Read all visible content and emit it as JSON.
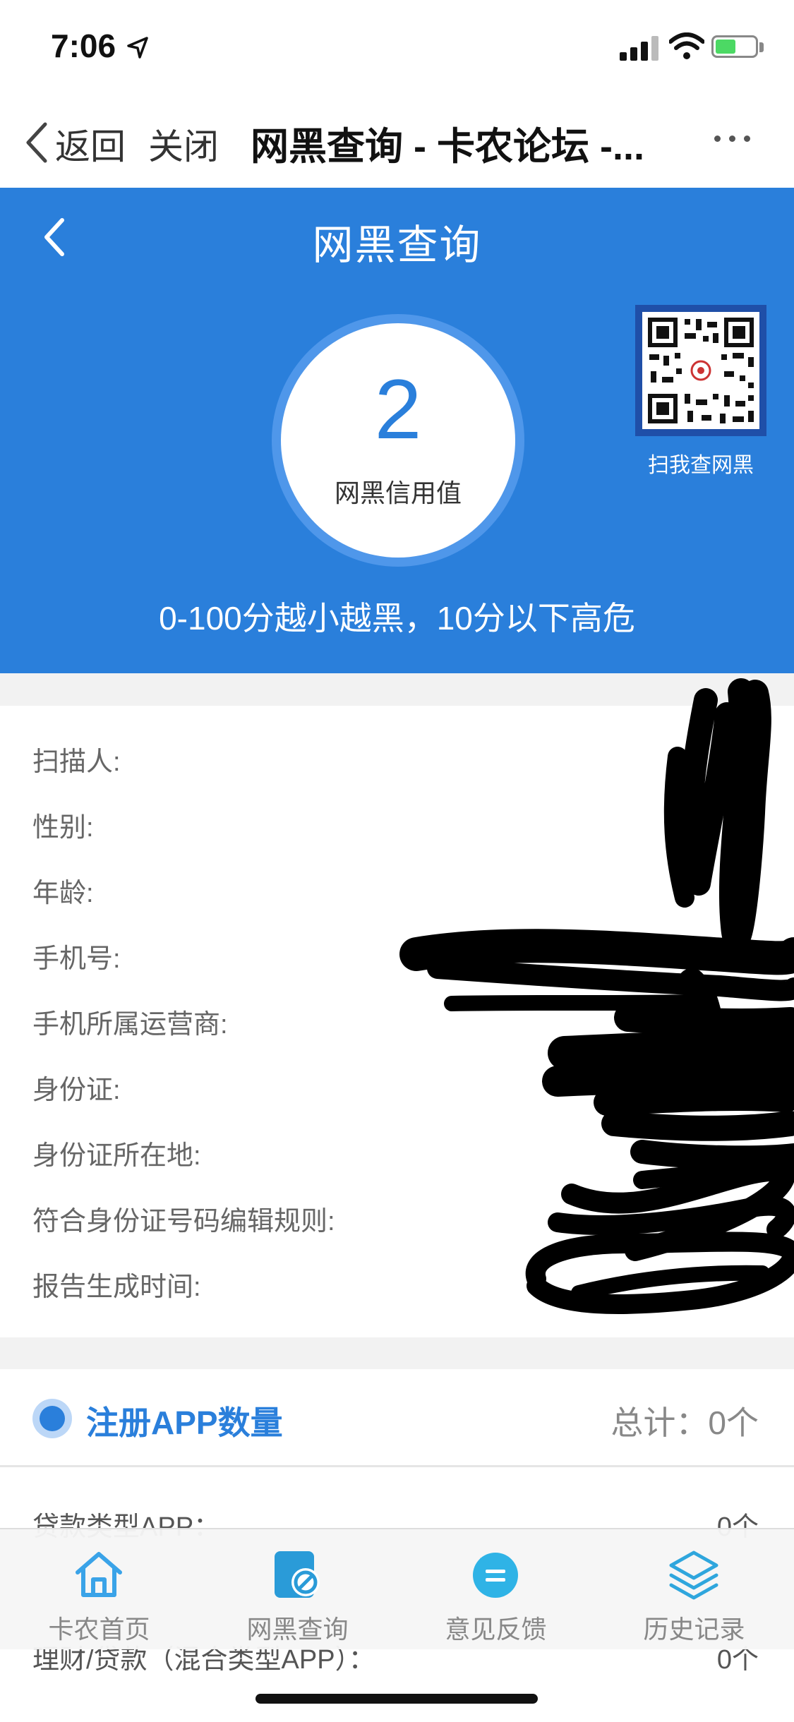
{
  "status_bar": {
    "time": "7:06"
  },
  "nav": {
    "back_label": "返回",
    "close_label": "关闭",
    "title": "网黑查询 - 卡农论坛 -..."
  },
  "hero": {
    "title": "网黑查询",
    "score": "2",
    "score_label": "网黑信用值",
    "qr_caption": "扫我查网黑",
    "note": "0-100分越小越黑，10分以下高危",
    "accent_color": "#2a7fdb"
  },
  "info_rows": [
    "扫描人:",
    "性别:",
    "年龄:",
    "手机号:",
    "手机所属运营商:",
    "身份证:",
    "身份证所在地:",
    "符合身份证号码编辑规则:",
    "报告生成时间:"
  ],
  "app_section": {
    "title": "注册APP数量",
    "total": "总计：0个",
    "rows": [
      {
        "label": "贷款类型APP：",
        "value": "0个"
      },
      {
        "label": "理财/贷款（混合类型APP）：",
        "value": "0个"
      }
    ]
  },
  "tabs": [
    {
      "label": "卡农首页",
      "icon": "home-icon"
    },
    {
      "label": "网黑查询",
      "icon": "blacklist-search-icon"
    },
    {
      "label": "意见反馈",
      "icon": "feedback-icon"
    },
    {
      "label": "历史记录",
      "icon": "layers-icon"
    }
  ]
}
